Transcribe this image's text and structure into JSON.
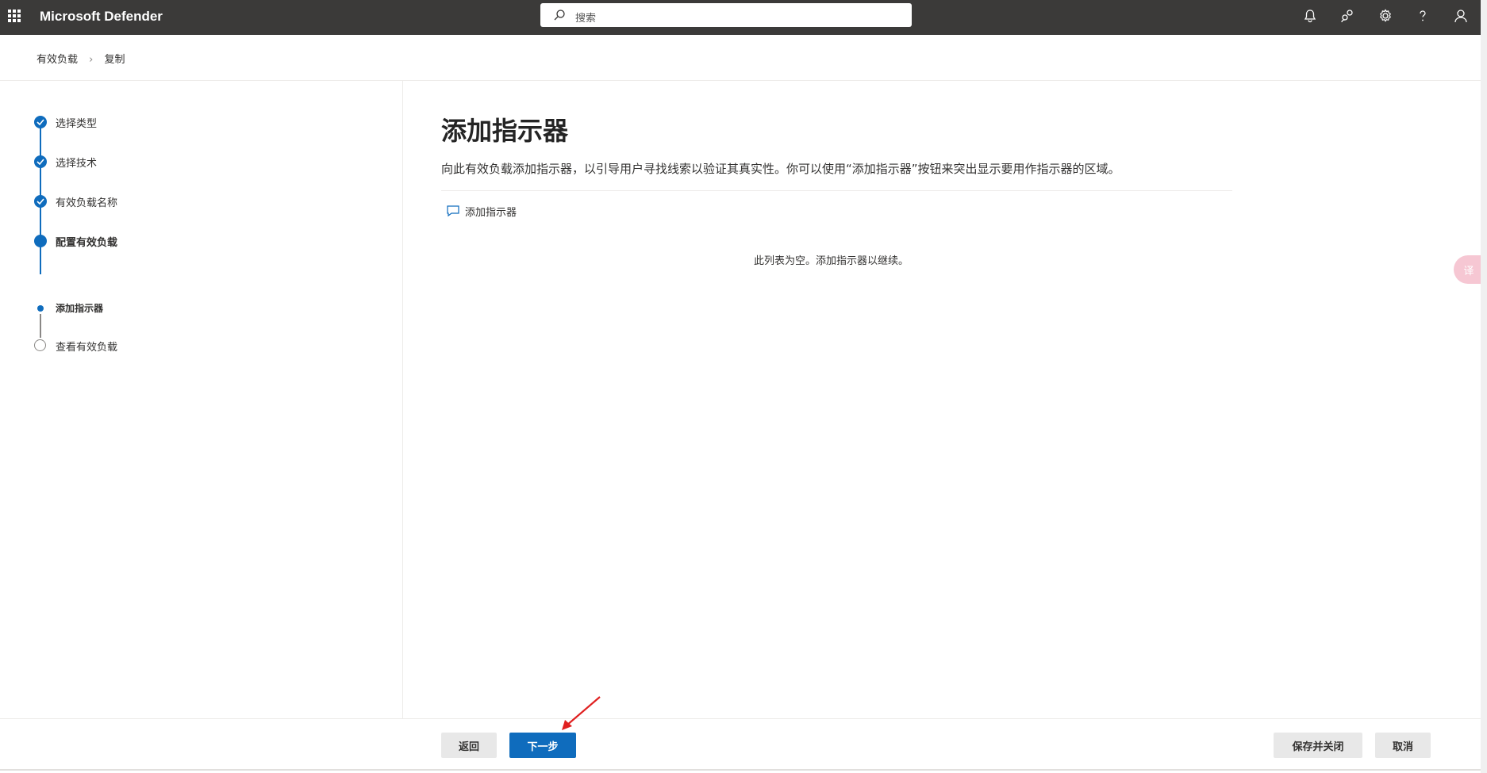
{
  "app": {
    "title": "Microsoft Defender"
  },
  "search": {
    "placeholder": "搜索"
  },
  "breadcrumb": {
    "items": [
      "有效负载",
      "复制"
    ]
  },
  "steps": [
    {
      "label": "选择类型",
      "state": "done"
    },
    {
      "label": "选择技术",
      "state": "done"
    },
    {
      "label": "有效负载名称",
      "state": "done"
    },
    {
      "label": "配置有效负载",
      "state": "current"
    },
    {
      "label": "添加指示器",
      "state": "current-sub"
    },
    {
      "label": "查看有效负载",
      "state": "pending"
    }
  ],
  "main": {
    "title": "添加指示器",
    "description": "向此有效负载添加指示器，以引导用户寻找线索以验证其真实性。你可以使用“添加指示器”按钮来突出显示要用作指示器的区域。",
    "add_button": "添加指示器",
    "empty_message": "此列表为空。添加指示器以继续。"
  },
  "footer": {
    "back": "返回",
    "next": "下一步",
    "save_close": "保存并关闭",
    "cancel": "取消"
  },
  "floating": {
    "translate_label": "译"
  },
  "colors": {
    "accent": "#0f6cbd",
    "topbar": "#3b3a39"
  }
}
